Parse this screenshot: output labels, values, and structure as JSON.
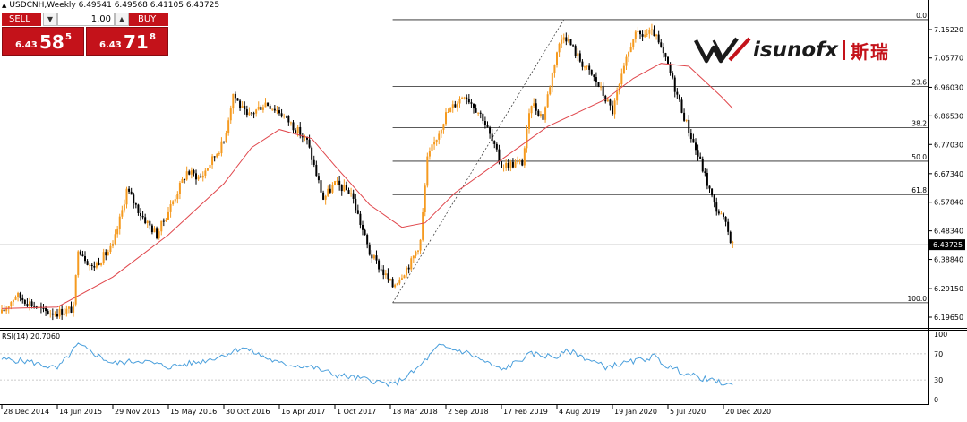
{
  "header": {
    "symbol_line": "USDCNH,Weekly  6.49541 6.49568 6.41105 6.43725"
  },
  "one_click_trading": {
    "sell_label": "SELL",
    "buy_label": "BUY",
    "volume": "1.00",
    "sell_price": {
      "prefix": "6.43",
      "big": "58",
      "sup": "5"
    },
    "buy_price": {
      "prefix": "6.43",
      "big": "71",
      "sup": "8"
    }
  },
  "watermark": {
    "brand": "isunofx",
    "brand_cn": "斯瑞"
  },
  "colors": {
    "bull_candle": "#f59a1f",
    "bear_candle": "#000000",
    "moving_average": "#e0474c",
    "rsi_line": "#4a9fdc",
    "trade_red": "#c4121a"
  },
  "chart_data": [
    {
      "type": "candlestick",
      "title": "USDCNH,Weekly",
      "current_price": "6.43725",
      "x_tick_labels": [
        "28 Dec 2014",
        "14 Jun 2015",
        "29 Nov 2015",
        "15 May 2016",
        "30 Oct 2016",
        "16 Apr 2017",
        "1 Oct 2017",
        "18 Mar 2018",
        "2 Sep 2018",
        "17 Feb 2019",
        "4 Aug 2019",
        "19 Jan 2020",
        "5 Jul 2020",
        "20 Dec 2020"
      ],
      "y_tick_labels": [
        "7.15220",
        "7.05770",
        "6.96030",
        "6.86530",
        "6.77030",
        "6.67340",
        "6.57840",
        "6.48340",
        "6.38840",
        "6.29150",
        "6.19650"
      ],
      "ylim": [
        6.18,
        7.2
      ],
      "fibonacci": {
        "high": 7.1852,
        "low": 6.2444,
        "levels": [
          {
            "label": "0.0",
            "price": 7.1852
          },
          {
            "label": "23.6",
            "price": 6.9632
          },
          {
            "label": "38.2",
            "price": 6.8258
          },
          {
            "label": "50.0",
            "price": 6.7148
          },
          {
            "label": "61.8",
            "price": 6.6038
          },
          {
            "label": "100.0",
            "price": 6.2444
          }
        ]
      },
      "trend_line": {
        "from": {
          "date": "2018-03-25",
          "price": 6.2444
        },
        "to": {
          "date": "2019-08-25",
          "price": 7.1852
        }
      },
      "close_path": [
        {
          "date": "2014-12-28",
          "close": 6.21
        },
        {
          "date": "2015-02-08",
          "close": 6.27
        },
        {
          "date": "2015-03-22",
          "close": 6.245
        },
        {
          "date": "2015-05-03",
          "close": 6.215
        },
        {
          "date": "2015-06-14",
          "close": 6.212
        },
        {
          "date": "2015-08-02",
          "close": 6.225
        },
        {
          "date": "2015-08-16",
          "close": 6.43
        },
        {
          "date": "2015-09-27",
          "close": 6.36
        },
        {
          "date": "2015-11-29",
          "close": 6.43
        },
        {
          "date": "2015-12-27",
          "close": 6.55
        },
        {
          "date": "2016-01-10",
          "close": 6.62
        },
        {
          "date": "2016-02-21",
          "close": 6.54
        },
        {
          "date": "2016-04-10",
          "close": 6.47
        },
        {
          "date": "2016-05-15",
          "close": 6.55
        },
        {
          "date": "2016-07-10",
          "close": 6.68
        },
        {
          "date": "2016-08-21",
          "close": 6.66
        },
        {
          "date": "2016-10-30",
          "close": 6.78
        },
        {
          "date": "2016-11-27",
          "close": 6.94
        },
        {
          "date": "2017-01-08",
          "close": 6.86
        },
        {
          "date": "2017-03-05",
          "close": 6.91
        },
        {
          "date": "2017-04-16",
          "close": 6.88
        },
        {
          "date": "2017-05-21",
          "close": 6.84
        },
        {
          "date": "2017-07-09",
          "close": 6.78
        },
        {
          "date": "2017-08-27",
          "close": 6.59
        },
        {
          "date": "2017-10-01",
          "close": 6.64
        },
        {
          "date": "2017-11-19",
          "close": 6.61
        },
        {
          "date": "2018-01-14",
          "close": 6.41
        },
        {
          "date": "2018-03-25",
          "close": 6.3
        },
        {
          "date": "2018-05-20",
          "close": 6.38
        },
        {
          "date": "2018-06-17",
          "close": 6.45
        },
        {
          "date": "2018-07-08",
          "close": 6.72
        },
        {
          "date": "2018-09-02",
          "close": 6.87
        },
        {
          "date": "2018-10-28",
          "close": 6.94
        },
        {
          "date": "2018-12-23",
          "close": 6.86
        },
        {
          "date": "2019-02-17",
          "close": 6.7
        },
        {
          "date": "2019-04-21",
          "close": 6.71
        },
        {
          "date": "2019-05-19",
          "close": 6.91
        },
        {
          "date": "2019-06-23",
          "close": 6.86
        },
        {
          "date": "2019-08-04",
          "close": 7.08
        },
        {
          "date": "2019-08-25",
          "close": 7.14
        },
        {
          "date": "2019-10-13",
          "close": 7.05
        },
        {
          "date": "2019-12-01",
          "close": 6.98
        },
        {
          "date": "2020-01-19",
          "close": 6.88
        },
        {
          "date": "2020-02-23",
          "close": 7.02
        },
        {
          "date": "2020-03-22",
          "close": 7.13
        },
        {
          "date": "2020-05-24",
          "close": 7.14
        },
        {
          "date": "2020-07-05",
          "close": 7.03
        },
        {
          "date": "2020-08-30",
          "close": 6.84
        },
        {
          "date": "2020-10-18",
          "close": 6.69
        },
        {
          "date": "2020-11-22",
          "close": 6.57
        },
        {
          "date": "2020-12-20",
          "close": 6.52
        },
        {
          "date": "2021-01-17",
          "close": 6.437
        }
      ],
      "moving_average_path": [
        {
          "date": "2014-12-28",
          "value": 6.225
        },
        {
          "date": "2015-06-14",
          "value": 6.23
        },
        {
          "date": "2015-11-29",
          "value": 6.33
        },
        {
          "date": "2016-05-15",
          "value": 6.47
        },
        {
          "date": "2016-10-30",
          "value": 6.64
        },
        {
          "date": "2017-01-22",
          "value": 6.76
        },
        {
          "date": "2017-04-16",
          "value": 6.82
        },
        {
          "date": "2017-07-23",
          "value": 6.79
        },
        {
          "date": "2017-10-01",
          "value": 6.7
        },
        {
          "date": "2018-01-14",
          "value": 6.57
        },
        {
          "date": "2018-04-22",
          "value": 6.495
        },
        {
          "date": "2018-07-01",
          "value": 6.51
        },
        {
          "date": "2018-09-30",
          "value": 6.61
        },
        {
          "date": "2019-02-17",
          "value": 6.72
        },
        {
          "date": "2019-07-07",
          "value": 6.83
        },
        {
          "date": "2019-12-29",
          "value": 6.92
        },
        {
          "date": "2020-03-22",
          "value": 6.99
        },
        {
          "date": "2020-06-14",
          "value": 7.04
        },
        {
          "date": "2020-09-06",
          "value": 7.03
        },
        {
          "date": "2020-12-13",
          "value": 6.93
        },
        {
          "date": "2021-01-17",
          "value": 6.89
        }
      ]
    },
    {
      "type": "line",
      "title": "RSI(14) 20.7060",
      "y_tick_labels": [
        "100",
        "70",
        "30",
        "0"
      ],
      "ylim": [
        0,
        100
      ],
      "levels": [
        70,
        30
      ],
      "series": [
        {
          "name": "RSI(14)",
          "points": [
            {
              "date": "2014-12-28",
              "value": 62
            },
            {
              "date": "2015-03-22",
              "value": 58
            },
            {
              "date": "2015-06-14",
              "value": 47
            },
            {
              "date": "2015-08-16",
              "value": 84
            },
            {
              "date": "2015-11-29",
              "value": 55
            },
            {
              "date": "2016-02-21",
              "value": 60
            },
            {
              "date": "2016-05-15",
              "value": 50
            },
            {
              "date": "2016-08-21",
              "value": 58
            },
            {
              "date": "2016-10-30",
              "value": 68
            },
            {
              "date": "2016-12-25",
              "value": 80
            },
            {
              "date": "2017-04-16",
              "value": 55
            },
            {
              "date": "2017-07-23",
              "value": 50
            },
            {
              "date": "2017-10-01",
              "value": 38
            },
            {
              "date": "2018-01-14",
              "value": 30
            },
            {
              "date": "2018-03-25",
              "value": 22
            },
            {
              "date": "2018-06-03",
              "value": 45
            },
            {
              "date": "2018-08-12",
              "value": 82
            },
            {
              "date": "2018-11-04",
              "value": 72
            },
            {
              "date": "2019-02-17",
              "value": 45
            },
            {
              "date": "2019-05-19",
              "value": 70
            },
            {
              "date": "2019-08-04",
              "value": 65
            },
            {
              "date": "2019-09-08",
              "value": 75
            },
            {
              "date": "2019-12-29",
              "value": 50
            },
            {
              "date": "2020-03-22",
              "value": 58
            },
            {
              "date": "2020-05-24",
              "value": 66
            },
            {
              "date": "2020-07-05",
              "value": 50
            },
            {
              "date": "2020-09-27",
              "value": 35
            },
            {
              "date": "2020-11-22",
              "value": 28
            },
            {
              "date": "2020-12-20",
              "value": 25
            },
            {
              "date": "2021-01-17",
              "value": 20.7
            }
          ]
        }
      ]
    }
  ]
}
